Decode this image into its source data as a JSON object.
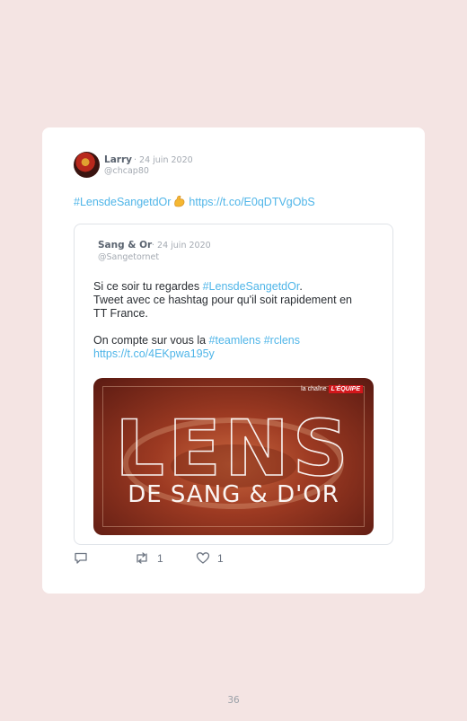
{
  "tweet": {
    "author_name": "Larry",
    "date": "· 24 juin 2020",
    "handle": "@chcap80",
    "hashtag": "#LensdeSangetdOr",
    "emoji": "flexed-biceps-emoji",
    "link": "https://t.co/E0qDTVgObS"
  },
  "quoted_tweet": {
    "author_name": "Sang & Or",
    "date": "· 24 juin 2020",
    "handle": "@Sangetornet",
    "line1_prefix": "Si ce soir tu regardes ",
    "line1_hashtag": "#LensdeSangetdOr",
    "line1_suffix": ".",
    "line2": "Tweet avec ce hashtag pour qu'il soit rapidement en",
    "line3": "TT France.",
    "line4_prefix": "On compte sur vous la ",
    "line4_hashtag1": "#teamlens",
    "line4_hashtag2": "#rclens",
    "line5_link": "https://t.co/4EKpwa195y",
    "media": {
      "title": "LENS",
      "subtitle": "DE SANG & D'OR",
      "logo_prefix": "la chaîne",
      "logo_brand": "L'ÉQUIPE"
    }
  },
  "actions": {
    "reply_icon": "reply-icon",
    "retweet_icon": "retweet-icon",
    "retweet_count": "1",
    "like_icon": "heart-icon",
    "like_count": "1"
  },
  "page_number": "36",
  "colors": {
    "background": "#f4e4e3",
    "link": "#4fb5e8",
    "text": "#2a2e33",
    "muted": "#a4aab2"
  }
}
